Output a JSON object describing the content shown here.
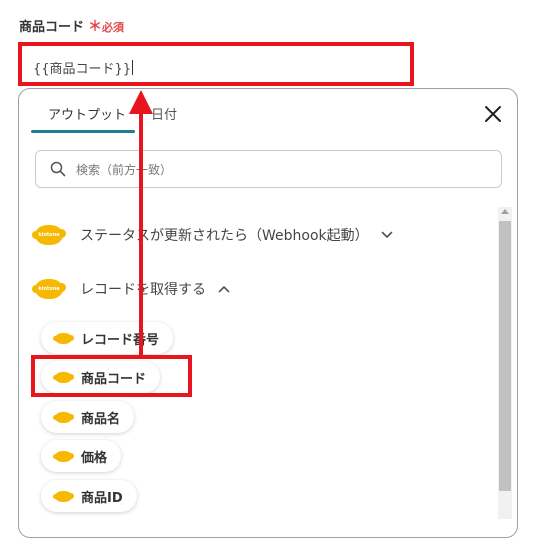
{
  "field": {
    "label": "商品コード",
    "required_mark": "＊",
    "required_text": "必須",
    "value": "{{商品コード}}"
  },
  "panel": {
    "tabs": [
      {
        "label": "アウトプット",
        "active": true
      },
      {
        "label": "日付",
        "active": false
      }
    ],
    "search_placeholder": "検索（前方一致）",
    "groups": [
      {
        "label": "ステータスが更新されたら（Webhook起動）",
        "expanded": false,
        "app": "kintone"
      },
      {
        "label": "レコードを取得する",
        "expanded": true,
        "app": "kintone"
      }
    ],
    "items": [
      "レコード番号",
      "商品コード",
      "商品名",
      "価格",
      "商品ID"
    ]
  },
  "colors": {
    "highlight": "#e8141e",
    "accent": "#1a7f8e",
    "kintone": "#f6b800",
    "required": "#e5484d"
  },
  "icons": {
    "close": "close-icon",
    "search": "search-icon",
    "chevron_down": "chevron-down-icon",
    "chevron_up": "chevron-up-icon",
    "kintone": "kintone-icon"
  }
}
